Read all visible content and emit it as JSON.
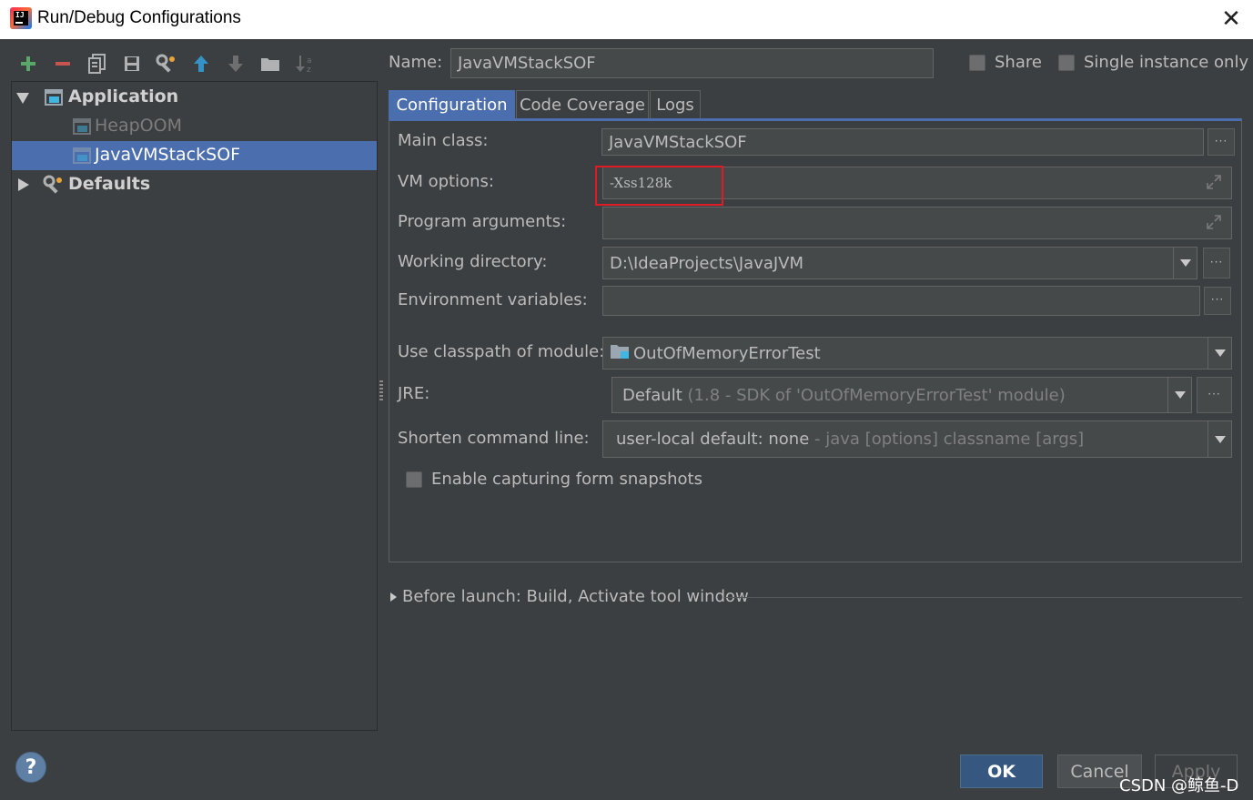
{
  "window": {
    "title": "Run/Debug Configurations",
    "close_glyph": "✕"
  },
  "toolbar": {
    "icons": [
      "add-icon",
      "remove-icon",
      "copy-icon",
      "save-icon",
      "edit-defaults-icon",
      "move-up-icon",
      "move-down-icon",
      "folder-icon",
      "sort-icon"
    ]
  },
  "tree": {
    "items": [
      {
        "label": "Application",
        "expanded": true,
        "bold": true
      },
      {
        "label": "HeapOOM"
      },
      {
        "label": "JavaVMStackSOF",
        "selected": true
      },
      {
        "label": "Defaults",
        "expanded": false,
        "bold": true
      }
    ]
  },
  "header": {
    "name_label": "Name:",
    "name_value": "JavaVMStackSOF",
    "share_label": "Share",
    "single_instance_label": "Single instance only"
  },
  "tabs": [
    {
      "label": "Configuration",
      "active": true
    },
    {
      "label": "Code Coverage"
    },
    {
      "label": "Logs"
    }
  ],
  "form": {
    "main_class_label": "Main class:",
    "main_class_value": "JavaVMStackSOF",
    "vm_options_label": "VM options:",
    "vm_options_value": "-Xss128k",
    "program_args_label": "Program arguments:",
    "program_args_value": "",
    "working_dir_label": "Working directory:",
    "working_dir_value": "D:\\IdeaProjects\\JavaJVM",
    "env_vars_label": "Environment variables:",
    "env_vars_value": "",
    "classpath_label": "Use classpath of module:",
    "classpath_value": "OutOfMemoryErrorTest",
    "jre_label": "JRE:",
    "jre_value": "Default",
    "jre_detail": "(1.8 - SDK of 'OutOfMemoryErrorTest' module)",
    "shorten_label": "Shorten command line:",
    "shorten_value": "user-local default: none",
    "shorten_detail": "- java [options] classname [args]",
    "snapshots_label": "Enable capturing form snapshots",
    "dots": "···"
  },
  "before_launch": {
    "label": "Before launch: Build, Activate tool window"
  },
  "buttons": {
    "help": "?",
    "ok": "OK",
    "cancel": "Cancel",
    "apply": "Apply"
  },
  "watermark": "CSDN @鲸鱼-D",
  "colors": {
    "background": "#3c3f41",
    "selection": "#4b6eaf",
    "highlight_box": "#e01b24",
    "add_green": "#59a869",
    "remove_red": "#c75450",
    "arrow_blue": "#3592c4"
  }
}
